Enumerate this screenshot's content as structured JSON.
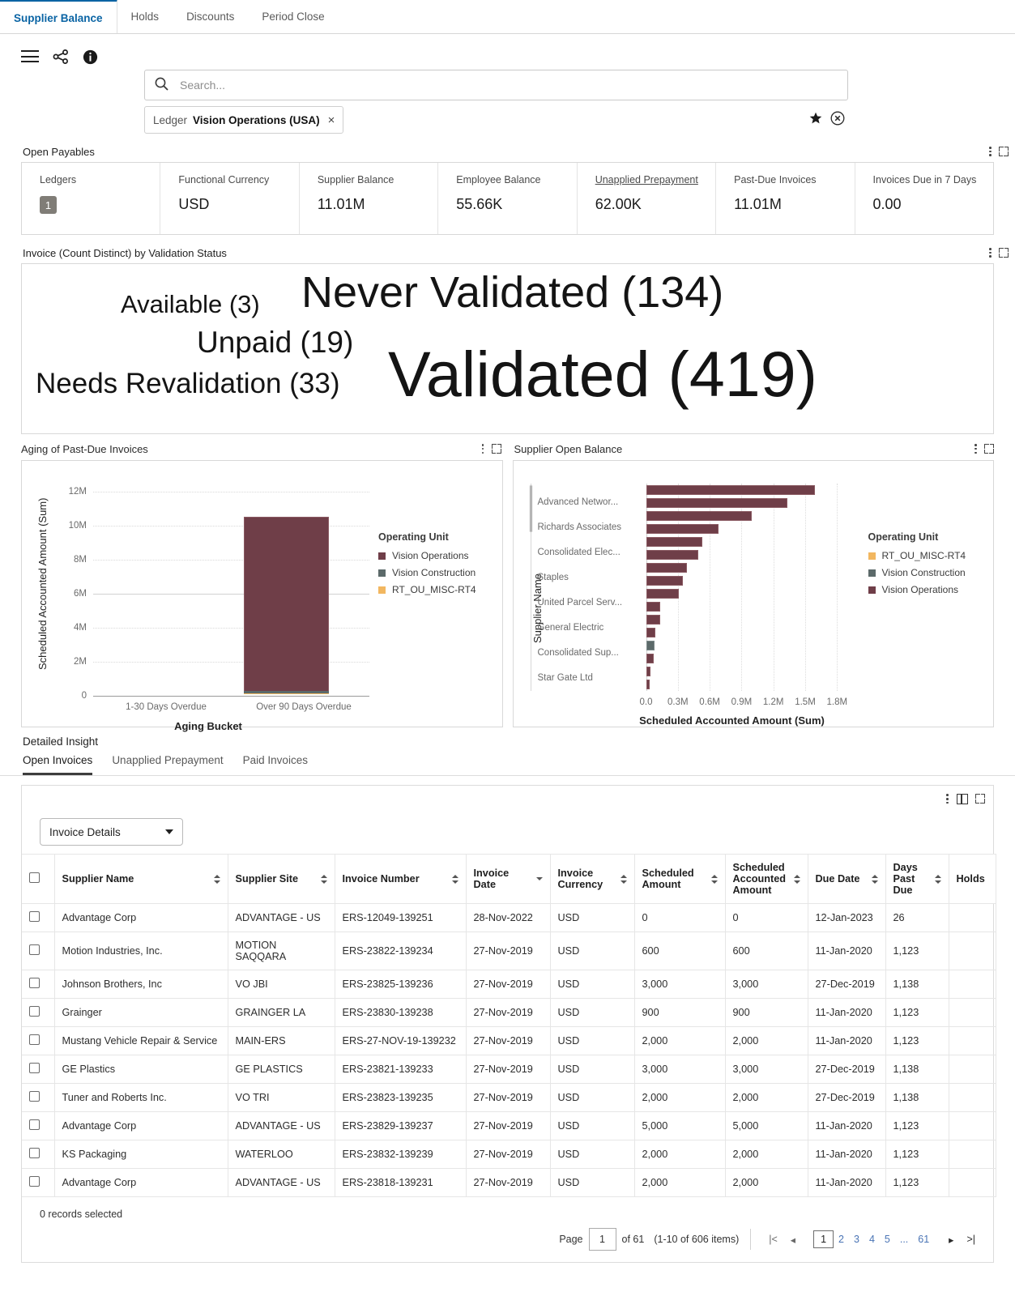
{
  "top_tabs": [
    {
      "label": "Supplier Balance",
      "active": true
    },
    {
      "label": "Holds",
      "active": false
    },
    {
      "label": "Discounts",
      "active": false
    },
    {
      "label": "Period Close",
      "active": false
    }
  ],
  "toolbar": {
    "menu_icon": "hamburger-icon",
    "share_icon": "share-icon",
    "info_icon": "info-icon"
  },
  "search": {
    "placeholder": "Search...",
    "value": "",
    "icon": "search-icon"
  },
  "filter": {
    "chip_label": "Ledger",
    "chip_value": "Vision Operations (USA)",
    "remove": "×",
    "favorite_icon": "star-icon",
    "clear_icon": "clear-circle-icon"
  },
  "open_payables": {
    "title": "Open Payables",
    "kpis": [
      {
        "label": "Ledgers",
        "value": "1",
        "badge": true,
        "underline": false
      },
      {
        "label": "Functional Currency",
        "value": "USD",
        "badge": false,
        "underline": false
      },
      {
        "label": "Supplier Balance",
        "value": "11.01M",
        "badge": false,
        "underline": false
      },
      {
        "label": "Employee Balance",
        "value": "55.66K",
        "badge": false,
        "underline": false
      },
      {
        "label": "Unapplied Prepayment",
        "value": "62.00K",
        "badge": false,
        "underline": true
      },
      {
        "label": "Past-Due Invoices",
        "value": "11.01M",
        "badge": false,
        "underline": false
      },
      {
        "label": "Invoices Due in 7 Days",
        "value": "0.00",
        "badge": false,
        "underline": false
      }
    ]
  },
  "word_cloud": {
    "title": "Invoice (Count Distinct) by Validation Status",
    "words": [
      {
        "text": "Available (3)",
        "size": 31,
        "left": 122,
        "top": 34
      },
      {
        "text": "Never Validated (134)",
        "size": 54,
        "left": 345,
        "top": 10
      },
      {
        "text": "Unpaid (19)",
        "size": 37,
        "left": 215,
        "top": 80
      },
      {
        "text": "Needs Revalidation (33)",
        "size": 35,
        "left": 17,
        "top": 132
      },
      {
        "text": "Validated (419)",
        "size": 79,
        "left": 450,
        "top": 95
      }
    ]
  },
  "chart_data": [
    {
      "type": "bar",
      "panel_title": "Aging of Past-Due Invoices",
      "title": "",
      "xlabel": "Aging Bucket",
      "ylabel": "Scheduled Accounted Amount (Sum)",
      "categories": [
        "1-30 Days Overdue",
        "Over 90 Days Overdue"
      ],
      "yticks": [
        "0",
        "2M",
        "4M",
        "6M",
        "8M",
        "10M",
        "12M"
      ],
      "ylim": [
        0,
        12000000
      ],
      "grid": true,
      "legend_position": "right",
      "legend_title": "Operating Unit",
      "series": [
        {
          "name": "Vision Operations",
          "color": "#6f3e48",
          "values": [
            0,
            10850000
          ]
        },
        {
          "name": "Vision Construction",
          "color": "#5c6a6a",
          "values": [
            0,
            120000
          ]
        },
        {
          "name": "RT_OU_MISC-RT4",
          "color": "#f2b760",
          "values": [
            0,
            20000
          ]
        }
      ]
    },
    {
      "type": "bar",
      "orientation": "horizontal",
      "panel_title": "Supplier Open Balance",
      "title": "",
      "xlabel": "Scheduled Accounted Amount (Sum)",
      "ylabel": "Supplier Name",
      "xticks": [
        "0.0",
        "0.3M",
        "0.6M",
        "0.9M",
        "1.2M",
        "1.5M",
        "1.8M"
      ],
      "xlim": [
        0,
        1900000
      ],
      "grid": true,
      "legend_position": "right",
      "legend_title": "Operating Unit",
      "legend_entries": [
        {
          "name": "RT_OU_MISC-RT4",
          "color": "#f2b760"
        },
        {
          "name": "Vision Construction",
          "color": "#5c6a6a"
        },
        {
          "name": "Vision Operations",
          "color": "#6f3e48"
        }
      ],
      "category_labels": [
        "Advanced Networ...",
        "Richards Associates",
        "Consolidated Elec...",
        "Staples",
        "United Parcel Serv...",
        "General Electric",
        "Consolidated Sup...",
        "Star Gate Ltd"
      ],
      "bars": [
        {
          "value": 1780000,
          "color": "#6f3e48"
        },
        {
          "value": 1490000,
          "color": "#6f3e48"
        },
        {
          "value": 1110000,
          "color": "#6f3e48"
        },
        {
          "value": 0.76,
          "unit": "M",
          "color": "#6f3e48"
        },
        {
          "value": 590000,
          "color": "#6f3e48"
        },
        {
          "value": 550000,
          "color": "#6f3e48"
        },
        {
          "value": 430000,
          "color": "#6f3e48"
        },
        {
          "value": 390000,
          "color": "#6f3e48"
        },
        {
          "value": 350000,
          "color": "#6f3e48"
        },
        {
          "value": 150000,
          "color": "#6f3e48"
        },
        {
          "value": 145000,
          "color": "#6f3e48"
        },
        {
          "value": 100000,
          "color": "#6f3e48"
        },
        {
          "value": 92000,
          "color": "#5c6a6a"
        },
        {
          "value": 80000,
          "color": "#6f3e48"
        },
        {
          "value": 48000,
          "color": "#6f3e48"
        },
        {
          "value": 42000,
          "color": "#6f3e48"
        }
      ]
    }
  ],
  "detailed_insight": {
    "title": "Detailed Insight",
    "tabs": [
      {
        "label": "Open Invoices",
        "active": true
      },
      {
        "label": "Unapplied Prepayment",
        "active": false
      },
      {
        "label": "Paid Invoices",
        "active": false
      }
    ],
    "view_selector": "Invoice Details",
    "columns": [
      "Supplier Name",
      "Supplier Site",
      "Invoice Number",
      "Invoice Date",
      "Invoice Currency",
      "Scheduled Amount",
      "Scheduled Accounted Amount",
      "Due Date",
      "Days Past Due",
      "Holds"
    ],
    "rows": [
      {
        "supplier_name": "Advantage Corp",
        "supplier_site": "ADVANTAGE - US",
        "invoice_number": "ERS-12049-139251",
        "invoice_date": "28-Nov-2022",
        "currency": "USD",
        "scheduled_amount": "0",
        "scheduled_accounted_amount": "0",
        "due_date": "12-Jan-2023",
        "days_past_due": "26",
        "holds": ""
      },
      {
        "supplier_name": "Motion Industries, Inc.",
        "supplier_site": "MOTION SAQQARA",
        "invoice_number": "ERS-23822-139234",
        "invoice_date": "27-Nov-2019",
        "currency": "USD",
        "scheduled_amount": "600",
        "scheduled_accounted_amount": "600",
        "due_date": "11-Jan-2020",
        "days_past_due": "1,123",
        "holds": ""
      },
      {
        "supplier_name": "Johnson Brothers, Inc",
        "supplier_site": "VO JBI",
        "invoice_number": "ERS-23825-139236",
        "invoice_date": "27-Nov-2019",
        "currency": "USD",
        "scheduled_amount": "3,000",
        "scheduled_accounted_amount": "3,000",
        "due_date": "27-Dec-2019",
        "days_past_due": "1,138",
        "holds": ""
      },
      {
        "supplier_name": "Grainger",
        "supplier_site": "GRAINGER LA",
        "invoice_number": "ERS-23830-139238",
        "invoice_date": "27-Nov-2019",
        "currency": "USD",
        "scheduled_amount": "900",
        "scheduled_accounted_amount": "900",
        "due_date": "11-Jan-2020",
        "days_past_due": "1,123",
        "holds": ""
      },
      {
        "supplier_name": "Mustang Vehicle Repair & Service",
        "supplier_site": "MAIN-ERS",
        "invoice_number": "ERS-27-NOV-19-139232",
        "invoice_date": "27-Nov-2019",
        "currency": "USD",
        "scheduled_amount": "2,000",
        "scheduled_accounted_amount": "2,000",
        "due_date": "11-Jan-2020",
        "days_past_due": "1,123",
        "holds": ""
      },
      {
        "supplier_name": "GE Plastics",
        "supplier_site": "GE PLASTICS",
        "invoice_number": "ERS-23821-139233",
        "invoice_date": "27-Nov-2019",
        "currency": "USD",
        "scheduled_amount": "3,000",
        "scheduled_accounted_amount": "3,000",
        "due_date": "27-Dec-2019",
        "days_past_due": "1,138",
        "holds": ""
      },
      {
        "supplier_name": "Tuner and Roberts Inc.",
        "supplier_site": "VO TRI",
        "invoice_number": "ERS-23823-139235",
        "invoice_date": "27-Nov-2019",
        "currency": "USD",
        "scheduled_amount": "2,000",
        "scheduled_accounted_amount": "2,000",
        "due_date": "27-Dec-2019",
        "days_past_due": "1,138",
        "holds": ""
      },
      {
        "supplier_name": "Advantage Corp",
        "supplier_site": "ADVANTAGE - US",
        "invoice_number": "ERS-23829-139237",
        "invoice_date": "27-Nov-2019",
        "currency": "USD",
        "scheduled_amount": "5,000",
        "scheduled_accounted_amount": "5,000",
        "due_date": "11-Jan-2020",
        "days_past_due": "1,123",
        "holds": ""
      },
      {
        "supplier_name": "KS Packaging",
        "supplier_site": "WATERLOO",
        "invoice_number": "ERS-23832-139239",
        "invoice_date": "27-Nov-2019",
        "currency": "USD",
        "scheduled_amount": "2,000",
        "scheduled_accounted_amount": "2,000",
        "due_date": "11-Jan-2020",
        "days_past_due": "1,123",
        "holds": ""
      },
      {
        "supplier_name": "Advantage Corp",
        "supplier_site": "ADVANTAGE - US",
        "invoice_number": "ERS-23818-139231",
        "invoice_date": "27-Nov-2019",
        "currency": "USD",
        "scheduled_amount": "2,000",
        "scheduled_accounted_amount": "2,000",
        "due_date": "11-Jan-2020",
        "days_past_due": "1,123",
        "holds": ""
      }
    ],
    "records_selected": "0 records selected",
    "pagination": {
      "page_label": "Page",
      "page_value": "1",
      "of_label": "of 61",
      "items_label": "(1-10 of 606 items)",
      "pages": [
        "1",
        "2",
        "3",
        "4",
        "5",
        "...",
        "61"
      ],
      "current_page": "1",
      "first_icon": "first-page-icon",
      "prev_icon": "previous-page-icon",
      "next_icon": "next-page-icon",
      "last_icon": "last-page-icon"
    }
  }
}
